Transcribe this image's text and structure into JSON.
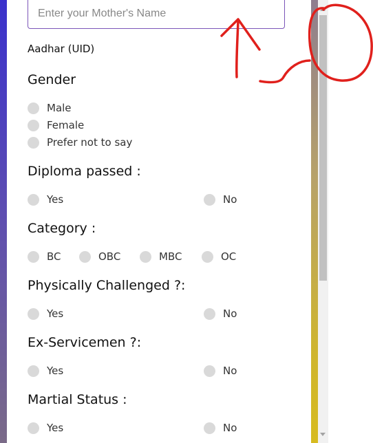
{
  "form": {
    "mother_name_placeholder": "Enter your Mother's Name",
    "aadhar_label": "Aadhar (UID)",
    "gender": {
      "heading": "Gender",
      "options": [
        "Male",
        "Female",
        "Prefer not to say"
      ]
    },
    "diploma": {
      "heading": "Diploma passed :",
      "options": [
        "Yes",
        "No"
      ]
    },
    "category": {
      "heading": "Category :",
      "options": [
        "BC",
        "OBC",
        "MBC",
        "OC"
      ]
    },
    "physically_challenged": {
      "heading": "Physically Challenged ?:",
      "options": [
        "Yes",
        "No"
      ]
    },
    "ex_servicemen": {
      "heading": "Ex-Servicemen ?:",
      "options": [
        "Yes",
        "No"
      ]
    },
    "martial_status": {
      "heading": "Martial Status :",
      "options": [
        "Yes",
        "No"
      ]
    }
  },
  "colors": {
    "annotation": "#e0201c",
    "input_border": "#7a54b8",
    "radio_fill": "#d9d9d9"
  }
}
